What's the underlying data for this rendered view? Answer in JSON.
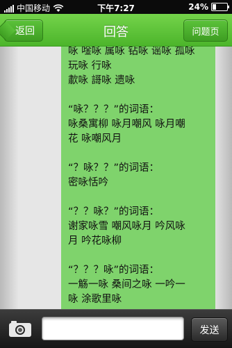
{
  "status_bar": {
    "carrier": "中国移动",
    "time": "下午7:27",
    "battery_text": "24%",
    "battery_level": 0.24,
    "signal_icon": "signal-bars-icon",
    "wifi_icon": "wifi-icon"
  },
  "nav": {
    "back_label": "返回",
    "title": "回答",
    "right_label": "问题页",
    "accent": "#5cc23a"
  },
  "answer": {
    "text": "咏 唫咏 属咏 钻咏 谣咏 孤咏\n玩咏 行咏\n歗咏 謌咏 遗咏\n\n“咏？？？”的词语：\n咏桑寓柳 咏月嘲风 咏月嘲\n花 咏嘲风月\n\n“？咏？？”的词语：\n密咏恬吟\n\n“？？咏？”的词语：\n谢家咏雪 嘲风咏月 吟风咏\n月 吟花咏柳\n\n“？？？咏”的词语：\n一觞一咏 桑间之咏 一吟一\n咏 涂歌里咏",
    "bubble_color": "#7fd36c"
  },
  "input_bar": {
    "camera_icon": "camera-icon",
    "input_placeholder": "",
    "send_label": "发送"
  }
}
